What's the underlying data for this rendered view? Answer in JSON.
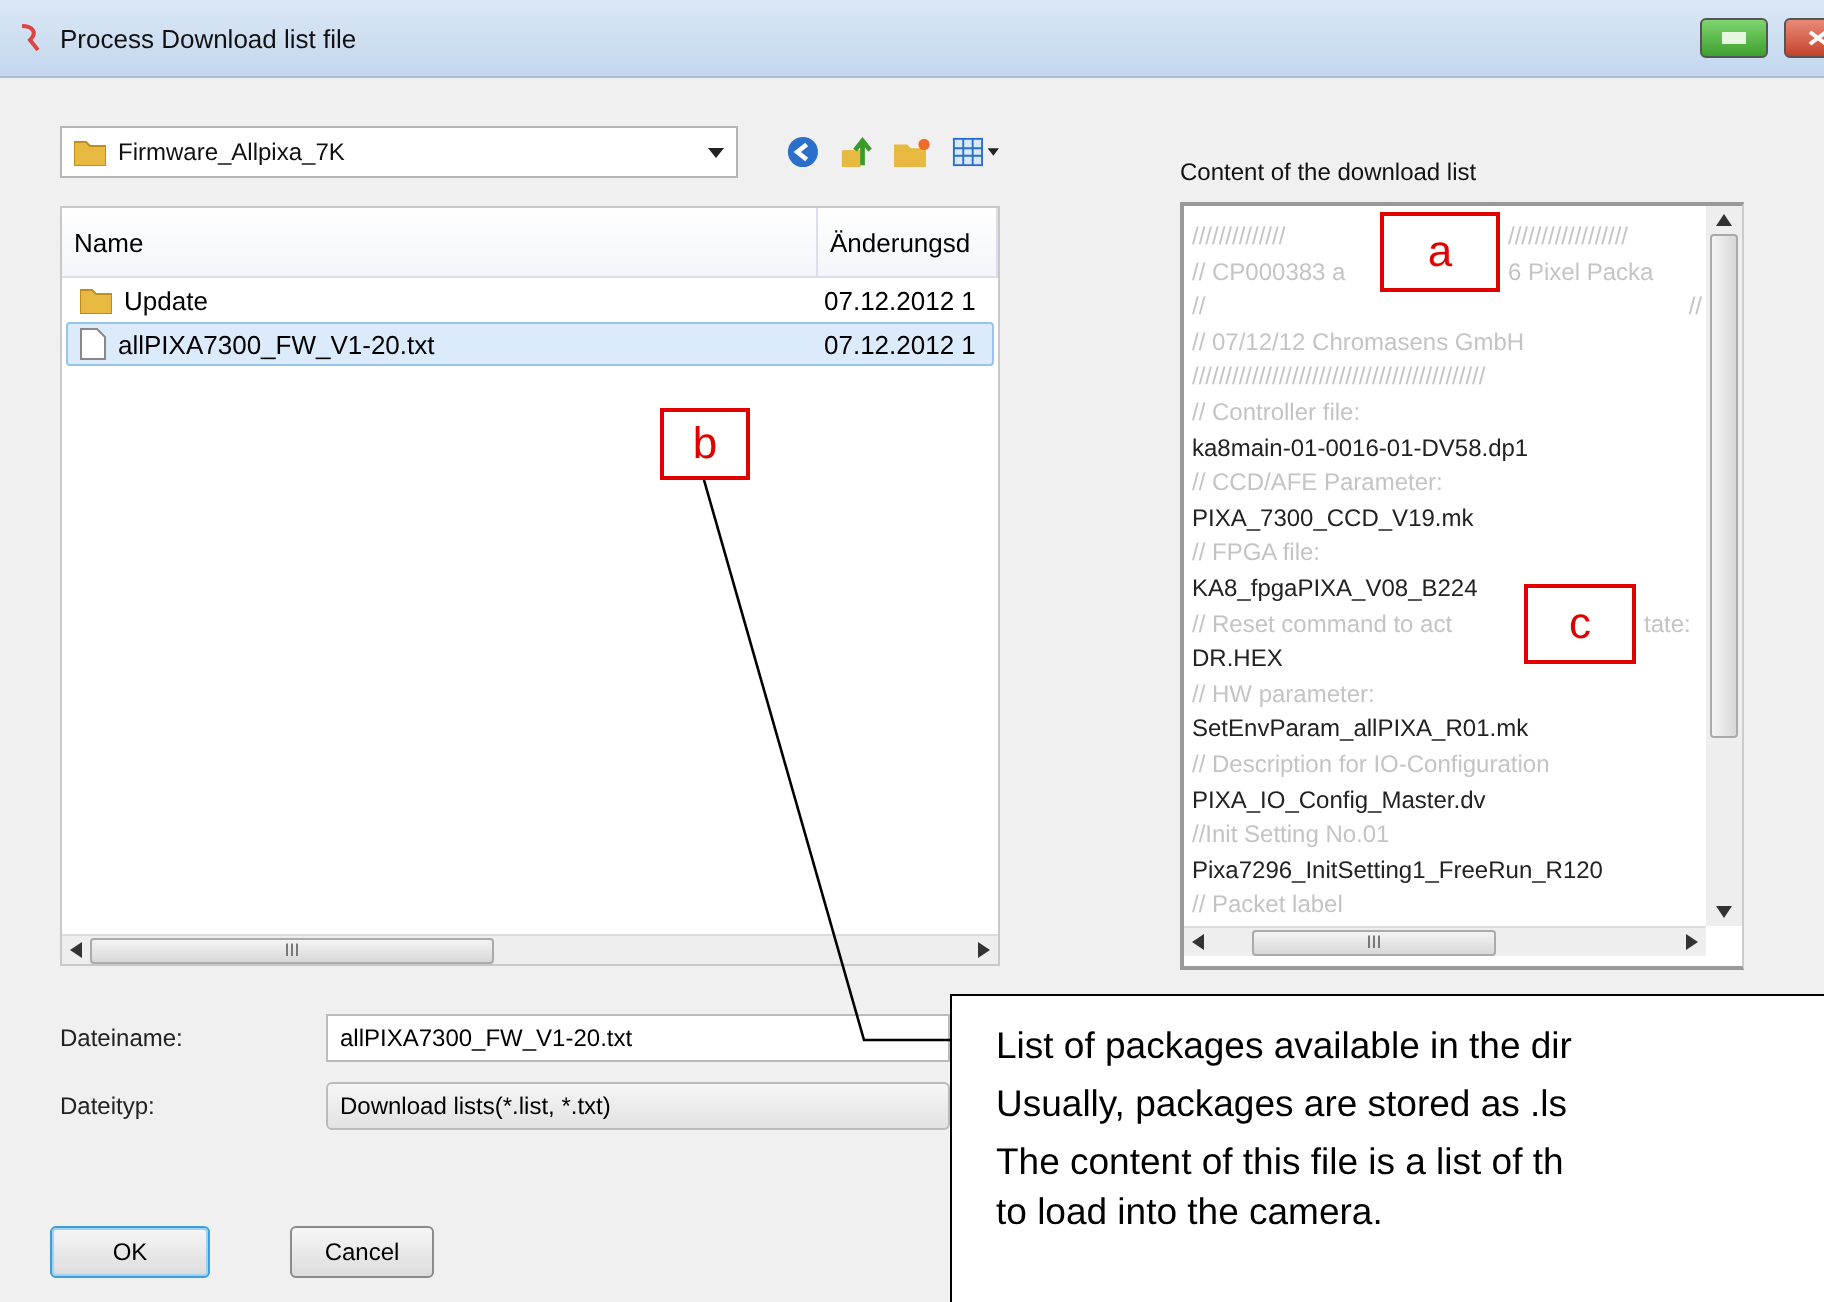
{
  "window": {
    "title": "Process Download list file"
  },
  "folder_combo": {
    "value": "Firmware_Allpixa_7K"
  },
  "file_list": {
    "columns": [
      "Name",
      "Änderungsd"
    ],
    "rows": [
      {
        "kind": "folder",
        "name": "Update",
        "date": "07.12.2012 1",
        "selected": false
      },
      {
        "kind": "file",
        "name": "allPIXA7300_FW_V1-20.txt",
        "date": "07.12.2012 1",
        "selected": true
      }
    ],
    "scroll_glyph": "III"
  },
  "content": {
    "label": "Content of the download list",
    "lines": [
      {
        "kind": "comment",
        "text": "//////////////",
        "after": "//////////////////"
      },
      {
        "kind": "comment",
        "text": "// CP000383 a",
        "after": "6 Pixel  Packa"
      },
      {
        "kind": "comment",
        "text": "//",
        "after": "//"
      },
      {
        "kind": "comment",
        "text": "// 07/12/12 Chromasens GmbH"
      },
      {
        "kind": "comment",
        "text": "////////////////////////////////////////////"
      },
      {
        "kind": "comment",
        "text": "// Controller file:"
      },
      {
        "kind": "file",
        "text": "ka8main-01-0016-01-DV58.dp1"
      },
      {
        "kind": "comment",
        "text": "// CCD/AFE Parameter:"
      },
      {
        "kind": "file",
        "text": "PIXA_7300_CCD_V19.mk"
      },
      {
        "kind": "comment",
        "text": "// FPGA file:"
      },
      {
        "kind": "file",
        "text": "KA8_fpgaPIXA_V08_B224"
      },
      {
        "kind": "comment",
        "text": "// Reset command to act",
        "after": "tate:"
      },
      {
        "kind": "file",
        "text": "DR.HEX"
      },
      {
        "kind": "comment",
        "text": "// HW parameter:"
      },
      {
        "kind": "file",
        "text": "SetEnvParam_allPIXA_R01.mk"
      },
      {
        "kind": "comment",
        "text": "// Description for IO-Configuration"
      },
      {
        "kind": "file",
        "text": "PIXA_IO_Config_Master.dv"
      },
      {
        "kind": "comment",
        "text": "//Init Setting No.01"
      },
      {
        "kind": "file",
        "text": "Pixa7296_InitSetting1_FreeRun_R120"
      },
      {
        "kind": "comment",
        "text": "// Packet label"
      }
    ],
    "scroll_glyph": "III"
  },
  "form": [
    {
      "label": "Dateiname:",
      "kind": "input",
      "value": "allPIXA7300_FW_V1-20.txt"
    },
    {
      "label": "Dateityp:",
      "kind": "select",
      "value": "Download lists(*.list, *.txt)"
    }
  ],
  "buttons": [
    {
      "label": "OK",
      "default": true
    },
    {
      "label": "Cancel",
      "default": false
    }
  ],
  "annotations": [
    {
      "label": "a"
    },
    {
      "label": "b"
    },
    {
      "label": "c"
    }
  ],
  "callout": {
    "lines": [
      "List of packages available in the dir",
      "Usually, packages are stored as .ls",
      "The content of this file is a list of th",
      "to load into the camera."
    ]
  }
}
